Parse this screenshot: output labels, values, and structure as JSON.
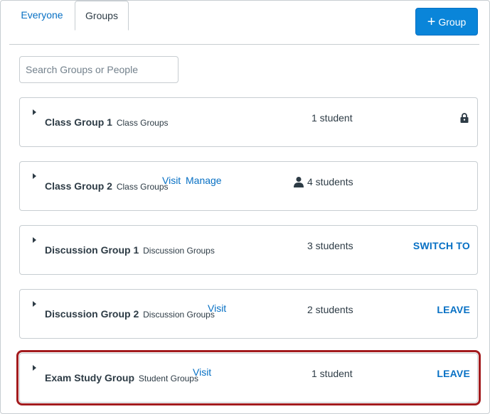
{
  "tabs": [
    {
      "label": "Everyone",
      "active": false
    },
    {
      "label": "Groups",
      "active": true
    }
  ],
  "add_group_button": {
    "icon": "plus-icon",
    "label": "Group"
  },
  "search": {
    "placeholder": "Search Groups or People",
    "value": ""
  },
  "groups": [
    {
      "name": "Class Group 1",
      "category": "Class Groups",
      "links": [],
      "count": "1 student",
      "count_icon": "",
      "action": "",
      "status_icon": "lock-icon"
    },
    {
      "name": "Class Group 2",
      "category": "Class Groups",
      "links": [
        "Visit",
        "Manage"
      ],
      "count": "4 students",
      "count_icon": "user-icon",
      "action": "",
      "status_icon": ""
    },
    {
      "name": "Discussion Group 1",
      "category": "Discussion Groups",
      "links": [],
      "count": "3 students",
      "count_icon": "",
      "action": "SWITCH TO",
      "status_icon": ""
    },
    {
      "name": "Discussion Group 2",
      "category": "Discussion Groups",
      "links": [
        "Visit"
      ],
      "count": "2 students",
      "count_icon": "",
      "action": "LEAVE",
      "status_icon": ""
    },
    {
      "name": "Exam Study Group",
      "category": "Student Groups",
      "links": [
        "Visit"
      ],
      "count": "1 student",
      "count_icon": "",
      "action": "LEAVE",
      "status_icon": "",
      "highlighted": true
    }
  ],
  "colors": {
    "link": "#0770c4",
    "button_bg": "#0a85d9",
    "highlight_border": "#a31b1e",
    "text": "#2d3b45",
    "border": "#c7cdd1"
  }
}
